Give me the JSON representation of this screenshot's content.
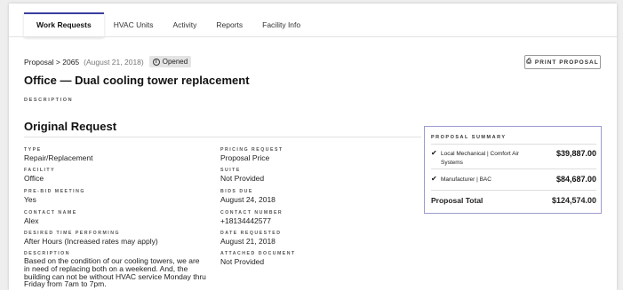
{
  "tabs": [
    {
      "label": "Work Requests",
      "active": true
    },
    {
      "label": "HVAC Units"
    },
    {
      "label": "Activity"
    },
    {
      "label": "Reports"
    },
    {
      "label": "Facility Info"
    }
  ],
  "breadcrumb": {
    "text": "Proposal > 2065",
    "date": "(August 21, 2018)",
    "status": "Opened"
  },
  "print_label": "PRINT PROPOSAL",
  "page_title": "Office — Dual cooling tower replacement",
  "description_label": "DESCRIPTION",
  "section_title": "Original Request",
  "fields_left": [
    {
      "label": "TYPE",
      "value": "Repair/Replacement"
    },
    {
      "label": "FACILITY",
      "value": "Office"
    },
    {
      "label": "PRE-BID MEETING",
      "value": "Yes"
    },
    {
      "label": "CONTACT NAME",
      "value": "Alex"
    },
    {
      "label": "DESIRED TIME PERFORMING",
      "value": "After Hours (Increased rates may apply)"
    },
    {
      "label": "DESCRIPTION",
      "value": "Based on the condition of our cooling towers, we are in need of replacing both on a weekend. And, the building can not be without HVAC service Monday thru Friday from 7am to 7pm."
    }
  ],
  "fields_right": [
    {
      "label": "PRICING REQUEST",
      "value": "Proposal Price"
    },
    {
      "label": "SUITE",
      "value": "Not Provided"
    },
    {
      "label": "BIDS DUE",
      "value": "August 24, 2018"
    },
    {
      "label": "CONTACT NUMBER",
      "value": "+18134442577"
    },
    {
      "label": "DATE REQUESTED",
      "value": "August 21, 2018"
    },
    {
      "label": "ATTACHED DOCUMENT",
      "value": "Not Provided"
    }
  ],
  "summary": {
    "heading": "PROPOSAL SUMMARY",
    "items": [
      {
        "name": "Local Mechanical | Comfort Air Systems",
        "amount": "$39,887.00"
      },
      {
        "name": "Manufacturer | BAC",
        "amount": "$84,687.00"
      }
    ],
    "total_label": "Proposal Total",
    "total_amount": "$124,574.00"
  },
  "colors": {
    "accent": "#3a3fa0",
    "summary_border": "#9c9ccf"
  }
}
